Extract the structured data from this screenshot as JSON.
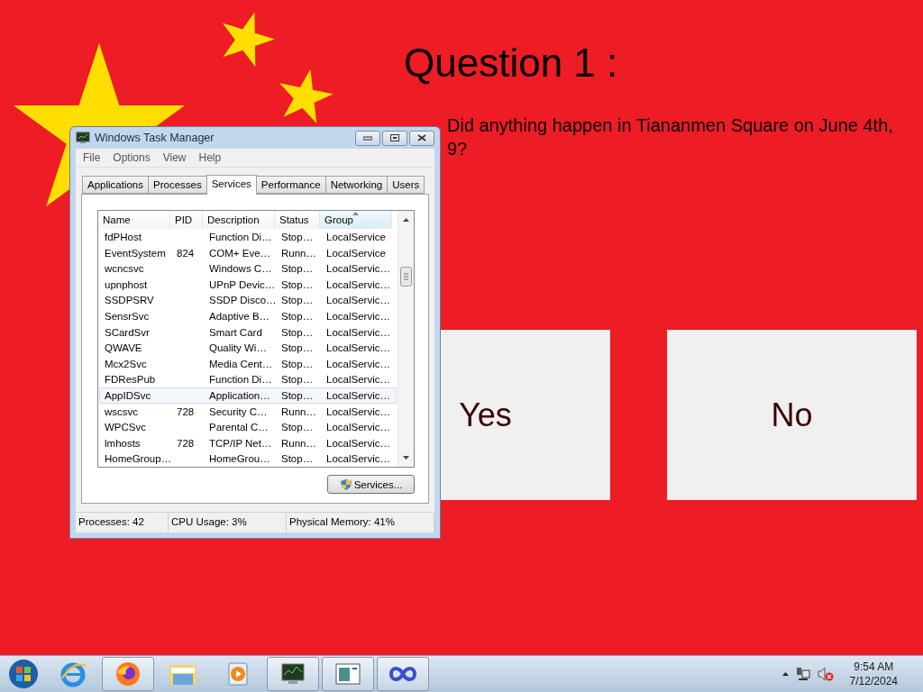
{
  "question": {
    "title": "Question 1 :",
    "text": "Did anything happen in Tiananmen Square on June 4th,",
    "text_continued": "9?"
  },
  "answers": [
    {
      "label": "Yes"
    },
    {
      "label": "No"
    }
  ],
  "task_manager": {
    "title": "Windows Task Manager",
    "menu": [
      "File",
      "Options",
      "View",
      "Help"
    ],
    "tabs": [
      {
        "label": "Applications",
        "selected": false
      },
      {
        "label": "Processes",
        "selected": false
      },
      {
        "label": "Services",
        "selected": true
      },
      {
        "label": "Performance",
        "selected": false
      },
      {
        "label": "Networking",
        "selected": false
      },
      {
        "label": "Users",
        "selected": false
      }
    ],
    "columns": [
      {
        "label": "Name",
        "sorted": false
      },
      {
        "label": "PID",
        "sorted": false
      },
      {
        "label": "Description",
        "sorted": false
      },
      {
        "label": "Status",
        "sorted": false
      },
      {
        "label": "Group",
        "sorted": true
      }
    ],
    "rows": [
      {
        "cells": [
          "fdPHost",
          "",
          "Function Di…",
          "Stop…",
          "LocalService"
        ],
        "selected": false
      },
      {
        "cells": [
          "EventSystem",
          "824",
          "COM+ Eve…",
          "Runn…",
          "LocalService"
        ],
        "selected": false
      },
      {
        "cells": [
          "wcncsvc",
          "",
          "Windows C…",
          "Stop…",
          "LocalServic…"
        ],
        "selected": false
      },
      {
        "cells": [
          "upnphost",
          "",
          "UPnP Devic…",
          "Stop…",
          "LocalServic…"
        ],
        "selected": false
      },
      {
        "cells": [
          "SSDPSRV",
          "",
          "SSDP Disco…",
          "Stop…",
          "LocalServic…"
        ],
        "selected": false
      },
      {
        "cells": [
          "SensrSvc",
          "",
          "Adaptive B…",
          "Stop…",
          "LocalServic…"
        ],
        "selected": false
      },
      {
        "cells": [
          "SCardSvr",
          "",
          "Smart Card",
          "Stop…",
          "LocalServic…"
        ],
        "selected": false
      },
      {
        "cells": [
          "QWAVE",
          "",
          "Quality Wi…",
          "Stop…",
          "LocalServic…"
        ],
        "selected": false
      },
      {
        "cells": [
          "Mcx2Svc",
          "",
          "Media Cent…",
          "Stop…",
          "LocalServic…"
        ],
        "selected": false
      },
      {
        "cells": [
          "FDResPub",
          "",
          "Function Di…",
          "Stop…",
          "LocalServic…"
        ],
        "selected": false
      },
      {
        "cells": [
          "AppIDSvc",
          "",
          "Application…",
          "Stop…",
          "LocalServic…"
        ],
        "selected": true
      },
      {
        "cells": [
          "wscsvc",
          "728",
          "Security C…",
          "Runn…",
          "LocalServic…"
        ],
        "selected": false
      },
      {
        "cells": [
          "WPCSvc",
          "",
          "Parental C…",
          "Stop…",
          "LocalServic…"
        ],
        "selected": false
      },
      {
        "cells": [
          "lmhosts",
          "728",
          "TCP/IP Net…",
          "Runn…",
          "LocalServic…"
        ],
        "selected": false
      },
      {
        "cells": [
          "HomeGroup…",
          "",
          "HomeGrou…",
          "Stop…",
          "LocalServic…"
        ],
        "selected": false
      }
    ],
    "services_button": "Services...",
    "status": [
      "Processes: 42",
      "CPU Usage: 3%",
      "Physical Memory: 41%"
    ]
  },
  "taskbar": {
    "apps": [
      {
        "kind": "ie",
        "open": false
      },
      {
        "kind": "firefox",
        "open": true
      },
      {
        "kind": "explorer",
        "open": false
      },
      {
        "kind": "media",
        "open": false
      },
      {
        "kind": "monitor",
        "open": true
      },
      {
        "kind": "document",
        "open": true
      },
      {
        "kind": "link",
        "open": true
      }
    ],
    "time": "9:54 AM",
    "date": "7/12/2024"
  }
}
